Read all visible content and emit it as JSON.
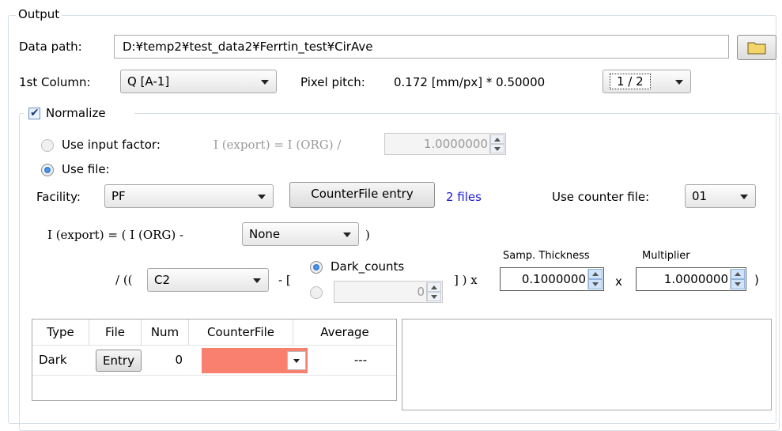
{
  "output": {
    "title": "Output",
    "data_path_label": "Data path:",
    "data_path_value": "D:¥temp2¥test_data2¥Ferrtin_test¥CirAve",
    "first_column_label": "1st Column:",
    "first_column_value": "Q [A-1]",
    "pixel_pitch_label": "Pixel pitch:",
    "pixel_pitch_value": "0.172 [mm/px] * 0.50000",
    "binning_value": "1 / 2"
  },
  "normalize": {
    "label": "Normalize",
    "checked": true,
    "input_factor_label": "Use input factor:",
    "input_factor_formula": "I (export) = I (ORG) /",
    "input_factor_value": "1.0000000",
    "use_file_label": "Use file:",
    "facility_label": "Facility:",
    "facility_value": "PF",
    "counter_file_entry_label": "CounterFile entry",
    "files_count": "2 files",
    "use_counter_file_label": "Use counter file:",
    "use_counter_file_value": "01",
    "formula_left": "I (export) = ( I (ORG) -",
    "subtract_value": "None",
    "formula_close": ")",
    "divide_open": "/ ((",
    "channel_value": "C2",
    "minus_bracket": "- [",
    "dark_counts_label": "Dark_counts",
    "dark_counts_value": "0",
    "bracket_times": "] ) x",
    "samp_thickness_label": "Samp. Thickness",
    "samp_thickness_value": "0.1000000",
    "times": "x",
    "multiplier_label": "Multiplier",
    "multiplier_value": "1.0000000",
    "close_paren": ")"
  },
  "table": {
    "headers": [
      "Type",
      "File",
      "Num",
      "CounterFile",
      "Average"
    ],
    "rows": [
      {
        "type": "Dark",
        "file": "Entry",
        "num": "0",
        "counter_file": "",
        "average": "---"
      }
    ]
  },
  "colors": {
    "counter_cell": "#f97f6e",
    "link_blue": "#1a1ad6"
  }
}
